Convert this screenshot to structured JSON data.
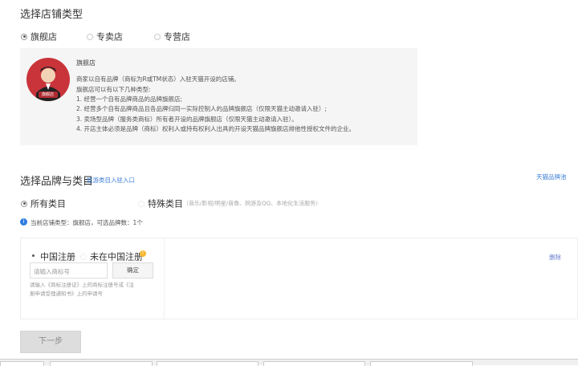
{
  "shop_type": {
    "title": "选择店铺类型",
    "options": [
      {
        "label": "旗舰店",
        "selected": true
      },
      {
        "label": "专卖店",
        "selected": false
      },
      {
        "label": "专营店",
        "selected": false
      }
    ],
    "description": {
      "avatar_badge": "旗舰店",
      "heading": "旗舰店",
      "lines": [
        "商家以自有品牌（商标为R或TM状态）入驻天猫开设的店铺。",
        "旗舰店可以有以下几种类型:",
        "1. 经营一个自有品牌商品的品牌旗舰店;",
        "2. 经营多个自有品牌商品且各品牌归同一实际控制人的品牌旗舰店（仅限天猫主动邀请入驻）;",
        "3. 卖场型品牌（服务类商标）所有者开设的品牌旗舰店（仅限天猫主动邀请入驻）。",
        "4. 开店主体必须是品牌（商标）权利人或持有权利人出具的开设天猫品牌旗舰店排他性授权文件的企业。"
      ]
    }
  },
  "brand": {
    "title": "选择品牌与类目",
    "travel_link": "旅游类目入驻入口",
    "pool_link": "天猫品牌池",
    "categories": [
      {
        "label": "所有类目",
        "selected": true
      },
      {
        "label": "特殊类目",
        "note": "（音乐/影视/明星/音像、网游及QQ、本地化生活服务）",
        "selected": false
      }
    ],
    "info": "当前店铺类型：旗舰店，可选品牌数：1个",
    "registration": [
      {
        "label": "中国注册",
        "selected": true
      },
      {
        "label": "未在中国注册",
        "selected": false
      }
    ],
    "trademark_placeholder": "请输入商标号",
    "confirm_label": "确定",
    "hint_lines": [
      "请输入《商标注册证》上的商标注册号或《注",
      "册申请受理通知书》上的申请号"
    ],
    "delete_label": "删除"
  },
  "next_label": "下一步",
  "colors": {
    "link": "#3d7fd6",
    "info": "#2f7de1",
    "warn": "#f5b82e"
  }
}
